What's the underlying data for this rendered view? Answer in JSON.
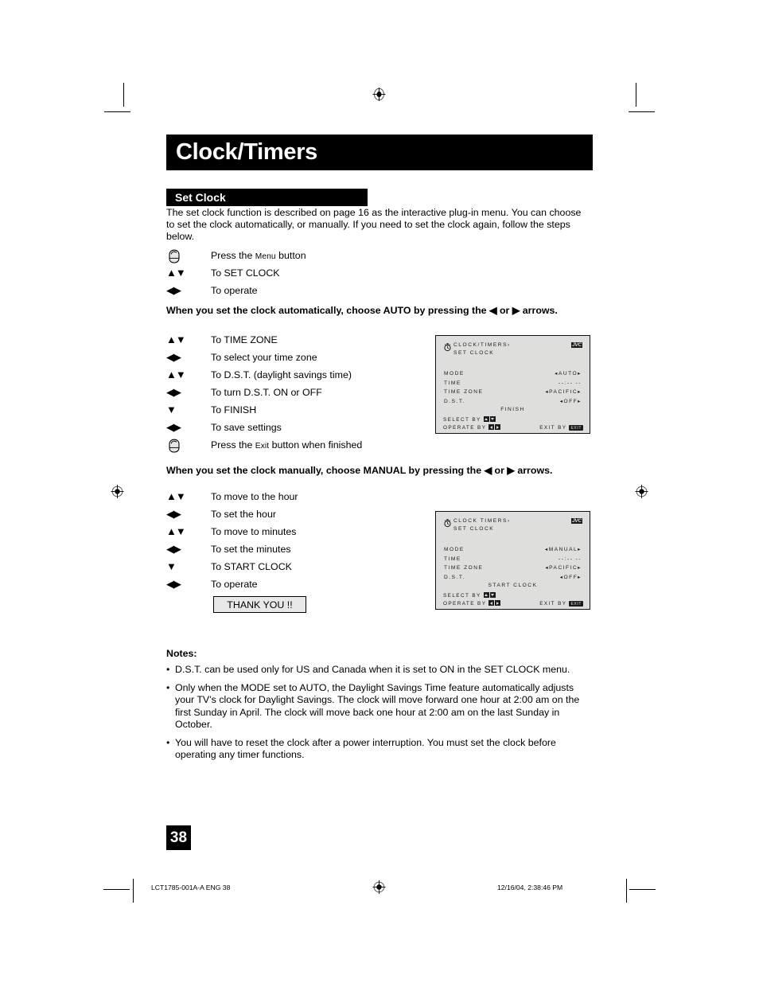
{
  "page": {
    "title": "Clock/Timers",
    "section": "Set Clock",
    "number": "38"
  },
  "intro": "The set clock function is described on page 16 as the interactive plug-in menu. You can choose to set the clock automatically, or manually. If you need to set the clock again, follow the steps below.",
  "steps_top": [
    {
      "key": "hand-icon",
      "text_pre": "Press the ",
      "text_sc": "Menu",
      "text_post": " button"
    },
    {
      "key": "updown",
      "text": "To SET CLOCK"
    },
    {
      "key": "leftright",
      "text": "To operate"
    }
  ],
  "lead_auto": {
    "pre": "When you set the clock automatically, choose AUTO by pressing the ",
    "left": "◀",
    "mid": " or ",
    "right": "▶",
    "post": " arrows."
  },
  "steps_auto": [
    {
      "key": "updown",
      "text": "To TIME ZONE"
    },
    {
      "key": "leftright",
      "text": "To select your time zone"
    },
    {
      "key": "updown",
      "text": "To D.S.T. (daylight savings time)"
    },
    {
      "key": "leftright",
      "text": "To turn D.S.T. ON or OFF"
    },
    {
      "key": "down",
      "text": "To FINISH"
    },
    {
      "key": "leftright",
      "text": "To save settings"
    },
    {
      "key": "hand-icon",
      "text_pre": "Press the ",
      "text_sc": "Exit",
      "text_post": " button when finished"
    }
  ],
  "lead_manual": {
    "pre": "When you set the clock manually, choose MANUAL by pressing the ",
    "left": "◀",
    "mid": " or ",
    "right": "▶",
    "post": " arrows."
  },
  "steps_manual": [
    {
      "key": "updown",
      "text": "To move to the hour"
    },
    {
      "key": "leftright",
      "text": "To set the hour"
    },
    {
      "key": "updown",
      "text": "To move to minutes"
    },
    {
      "key": "leftright",
      "text": "To set the minutes"
    },
    {
      "key": "down",
      "text": "To START CLOCK"
    },
    {
      "key": "leftright",
      "text": "To operate"
    }
  ],
  "thank_you": "THANK YOU !!",
  "osd_auto": {
    "title_line1": "CLOCK/TIMERS›",
    "title_line2": "SET CLOCK",
    "logo": "JVC",
    "rows": [
      {
        "label": "MODE",
        "value": "◂AUTO▸"
      },
      {
        "label": "TIME",
        "value": "--:-- --"
      },
      {
        "label": "TIME ZONE",
        "value": "◂PACIFIC▸"
      },
      {
        "label": "D.S.T.",
        "value": "◂OFF▸"
      }
    ],
    "center_action": "FINISH",
    "select_label": "SELECT    BY",
    "operate_label": "OPERATE BY",
    "exit_label": "EXIT BY",
    "exit_badge": "EXIT"
  },
  "osd_manual": {
    "title_line1": "CLOCK TIMERS›",
    "title_line2": "SET CLOCK",
    "logo": "JVC",
    "rows": [
      {
        "label": "MODE",
        "value": "◂MANUAL▸"
      },
      {
        "label": "TIME",
        "value": "--:-- --"
      },
      {
        "label": "TIME ZONE",
        "value": "◂PACIFIC▸"
      },
      {
        "label": "D.S.T.",
        "value": "◂OFF▸"
      }
    ],
    "center_action": "START CLOCK",
    "select_label": "SELECT    BY",
    "operate_label": "OPERATE BY",
    "exit_label": "EXIT BY",
    "exit_badge": "EXIT"
  },
  "notes": {
    "title": "Notes:",
    "items": [
      "D.S.T. can be used only for US and Canada when it is set to ON in the SET CLOCK menu.",
      "Only when the MODE set to AUTO, the Daylight Savings Time feature automatically adjusts your TV’s clock for Daylight Savings. The clock will move forward one hour at 2:00 am on the first Sunday in April. The clock will move back one hour at 2:00 am on the last Sunday in October.",
      "You will have to reset the clock after a power interruption. You must set the clock before operating any timer functions."
    ],
    "bullet": "•"
  },
  "footer": {
    "left": "LCT1785-001A-A ENG   38",
    "right": "12/16/04, 2:38:46 PM"
  }
}
